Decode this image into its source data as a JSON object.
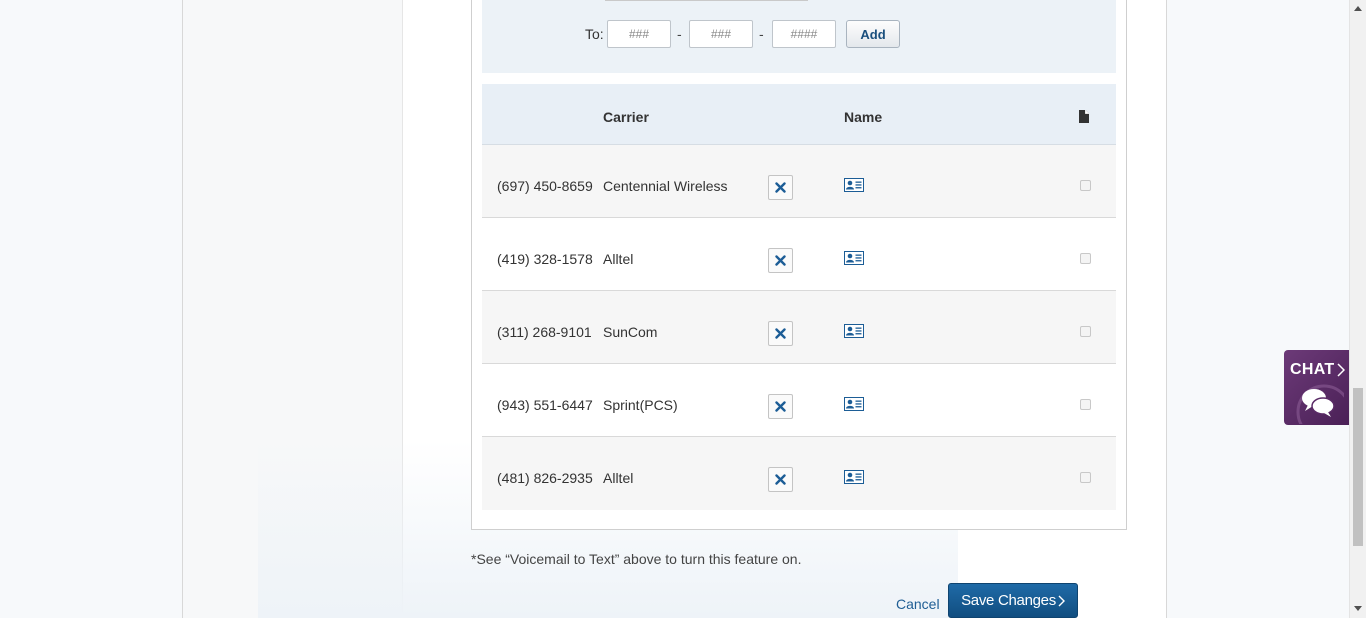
{
  "range_form": {
    "to_label": "To:",
    "area_placeholder": "###",
    "prefix_placeholder": "###",
    "line_placeholder": "####",
    "dash": "-",
    "add_label": "Add"
  },
  "table": {
    "headers": {
      "carrier": "Carrier",
      "name": "Name"
    },
    "header_icon": "document-icon",
    "rows": [
      {
        "phone": "(697) 450-8659",
        "carrier": "Centennial Wireless",
        "checked": false
      },
      {
        "phone": "(419) 328-1578",
        "carrier": "Alltel",
        "checked": false
      },
      {
        "phone": "(311) 268-9101",
        "carrier": "SunCom",
        "checked": false
      },
      {
        "phone": "(943) 551-6447",
        "carrier": "Sprint(PCS)",
        "checked": false
      },
      {
        "phone": "(481) 826-2935",
        "carrier": "Alltel",
        "checked": false
      }
    ],
    "row_delete_icon": "close-x-icon",
    "row_contact_icon": "contact-card-icon"
  },
  "footnote": "*See “Voicemail to Text” above to turn this feature on.",
  "actions": {
    "cancel_label": "Cancel",
    "save_label": "Save Changes"
  },
  "chat": {
    "label": "CHAT"
  },
  "colors": {
    "accent_blue": "#1a5f95",
    "header_bg": "#e8eff6",
    "chat_purple": "#5a2a66",
    "save_button": "#165a8f"
  }
}
